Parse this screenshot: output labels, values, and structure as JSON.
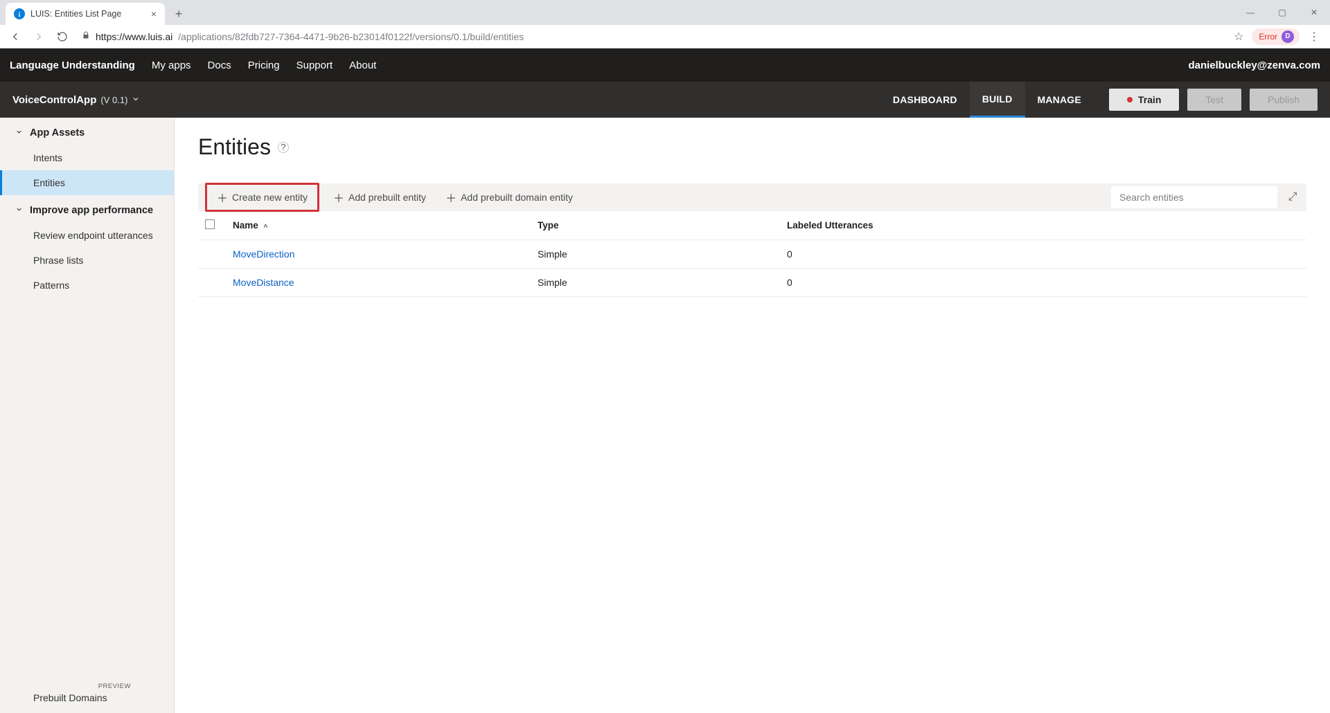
{
  "browser": {
    "tab_title": "LUIS: Entities List Page",
    "url_host": "https://www.luis.ai",
    "url_path": "/applications/82fdb727-7364-4471-9b26-b23014f0122f/versions/0.1/build/entities",
    "error_label": "Error",
    "avatar_letter": "D"
  },
  "topnav": {
    "brand": "Language Understanding",
    "links": [
      "My apps",
      "Docs",
      "Pricing",
      "Support",
      "About"
    ],
    "user": "danielbuckley@zenva.com"
  },
  "subnav": {
    "app_name": "VoiceControlApp",
    "version_label": "(V 0.1)",
    "tabs": [
      "DASHBOARD",
      "BUILD",
      "MANAGE"
    ],
    "active_tab": "BUILD",
    "train_label": "Train",
    "test_label": "Test",
    "publish_label": "Publish"
  },
  "sidebar": {
    "group_assets": "App Assets",
    "items_assets": [
      "Intents",
      "Entities"
    ],
    "active_item": "Entities",
    "group_improve": "Improve app performance",
    "items_improve": [
      "Review endpoint utterances",
      "Phrase lists",
      "Patterns"
    ],
    "prebuilt_label": "Prebuilt Domains",
    "preview_badge": "PREVIEW"
  },
  "page": {
    "title": "Entities",
    "toolbar": {
      "create": "Create new entity",
      "add_prebuilt": "Add prebuilt entity",
      "add_domain": "Add prebuilt domain entity",
      "search_placeholder": "Search entities"
    },
    "columns": {
      "name": "Name",
      "type": "Type",
      "labeled": "Labeled Utterances"
    },
    "rows": [
      {
        "name": "MoveDirection",
        "type": "Simple",
        "labeled": "0"
      },
      {
        "name": "MoveDistance",
        "type": "Simple",
        "labeled": "0"
      }
    ]
  }
}
